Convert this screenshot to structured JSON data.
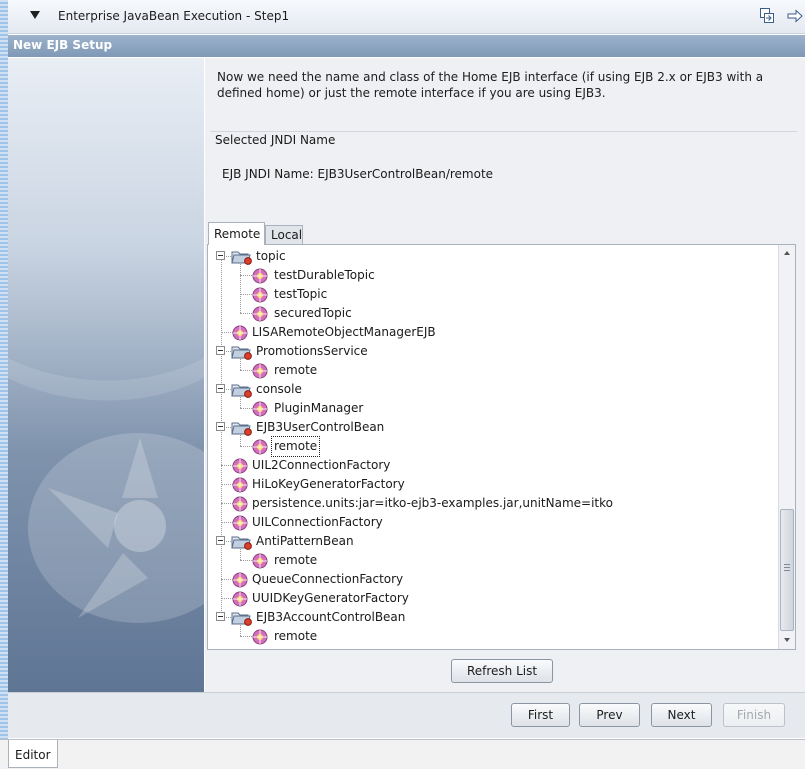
{
  "window": {
    "title": "Enterprise JavaBean Execution - Step1"
  },
  "section": {
    "title": "New EJB Setup"
  },
  "instructions": "Now we need the name and class of the Home EJB interface (if using EJB 2.x or EJB3 with a defined home) or just the remote interface if you are using EJB3.",
  "jndi": {
    "group_label": "Selected JNDI Name",
    "value": "EJB JNDI Name: EJB3UserControlBean/remote"
  },
  "tabs": {
    "remote": "Remote",
    "local": "Local"
  },
  "tree": {
    "nodes": [
      {
        "label": "topic",
        "type": "folder",
        "depth": 0
      },
      {
        "label": "testDurableTopic",
        "type": "bean",
        "depth": 1
      },
      {
        "label": "testTopic",
        "type": "bean",
        "depth": 1
      },
      {
        "label": "securedTopic",
        "type": "bean",
        "depth": 1
      },
      {
        "label": "LISARemoteObjectManagerEJB",
        "type": "bean",
        "depth": 0
      },
      {
        "label": "PromotionsService",
        "type": "folder",
        "depth": 0
      },
      {
        "label": "remote",
        "type": "bean",
        "depth": 1
      },
      {
        "label": "console",
        "type": "folder",
        "depth": 0
      },
      {
        "label": "PluginManager",
        "type": "bean",
        "depth": 1
      },
      {
        "label": "EJB3UserControlBean",
        "type": "folder",
        "depth": 0
      },
      {
        "label": "remote",
        "type": "bean",
        "depth": 1,
        "selected": true
      },
      {
        "label": "UIL2ConnectionFactory",
        "type": "bean",
        "depth": 0
      },
      {
        "label": "HiLoKeyGeneratorFactory",
        "type": "bean",
        "depth": 0
      },
      {
        "label": "persistence.units:jar=itko-ejb3-examples.jar,unitName=itko",
        "type": "bean",
        "depth": 0
      },
      {
        "label": "UILConnectionFactory",
        "type": "bean",
        "depth": 0
      },
      {
        "label": "AntiPatternBean",
        "type": "folder",
        "depth": 0
      },
      {
        "label": "remote",
        "type": "bean",
        "depth": 1
      },
      {
        "label": "QueueConnectionFactory",
        "type": "bean",
        "depth": 0
      },
      {
        "label": "UUIDKeyGeneratorFactory",
        "type": "bean",
        "depth": 0
      },
      {
        "label": "EJB3AccountControlBean",
        "type": "folder",
        "depth": 0
      },
      {
        "label": "remote",
        "type": "bean",
        "depth": 1
      }
    ]
  },
  "buttons": {
    "refresh": "Refresh List",
    "first": "First",
    "prev": "Prev",
    "next": "Next",
    "finish": "Finish"
  },
  "editor_tab": "Editor",
  "icons": {
    "collapse": "triangle-down-icon",
    "restore": "restore-window-icon",
    "navigate": "arrow-right-icon",
    "folder": "ejb-folder-icon",
    "bean": "ejb-bean-icon"
  },
  "colors": {
    "section_header": "#8ea6c2",
    "folder_badge": "#d8402c",
    "bean_icon": "#d56fbd"
  }
}
